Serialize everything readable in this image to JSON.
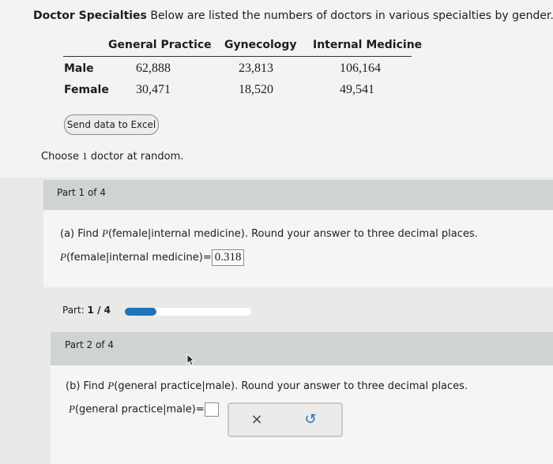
{
  "problem": {
    "title_bold": "Doctor Specialties",
    "title_rest": " Below are listed the numbers of doctors in various specialties by gender."
  },
  "table": {
    "columns": [
      "General Practice",
      "Gynecology",
      "Internal Medicine"
    ],
    "rows": [
      {
        "label": "Male",
        "values": [
          "62,888",
          "23,813",
          "106,164"
        ]
      },
      {
        "label": "Female",
        "values": [
          "30,471",
          "18,520",
          "49,541"
        ]
      }
    ]
  },
  "excel_button": "Send data to Excel",
  "choose_pre": "Choose ",
  "choose_num": "1",
  "choose_post": " doctor at random.",
  "part1": {
    "header": "Part 1 of 4",
    "q_prefix": "(a) Find ",
    "q_expr": "(female|internal medicine)",
    "q_suffix": ". Round your answer to three decimal places.",
    "a_expr": "(female|internal medicine)",
    "answer": "0.318"
  },
  "progress": {
    "label_pre": "Part: ",
    "label_val": "1 / 4",
    "fraction": 0.25
  },
  "part2": {
    "header": "Part 2 of 4",
    "q_prefix": "(b) Find ",
    "q_expr": "(general practice|male)",
    "q_suffix": ". Round your answer to three decimal places.",
    "a_expr": "(general practice|male)",
    "answer": ""
  },
  "symbols": {
    "p": "P",
    "eq": "="
  },
  "tools": {
    "clear": "×",
    "undo": "↺"
  }
}
